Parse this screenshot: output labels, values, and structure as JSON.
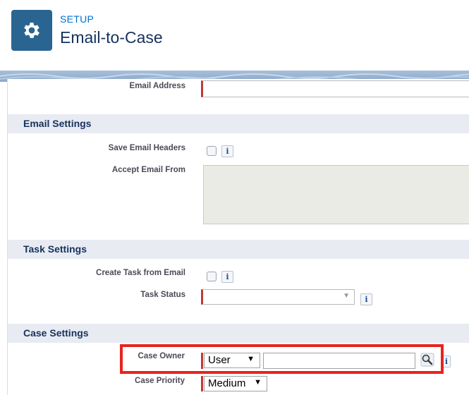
{
  "header": {
    "section": "SETUP",
    "title": "Email-to-Case",
    "icon": "gear-icon",
    "icon_bg": "#2a6592"
  },
  "fields": {
    "email_address_label": "Email Address",
    "email_address_value": ""
  },
  "sections": {
    "email_settings": {
      "title": "Email Settings",
      "save_headers_label": "Save Email Headers",
      "accept_from_label": "Accept Email From",
      "accept_from_value": ""
    },
    "task_settings": {
      "title": "Task Settings",
      "create_task_label": "Create Task from Email",
      "task_status_label": "Task Status",
      "task_status_value": ""
    },
    "case_settings": {
      "title": "Case Settings",
      "case_owner_label": "Case Owner",
      "case_owner_type": "User",
      "case_owner_value": "",
      "case_priority_label": "Case Priority",
      "case_priority_value": "Medium"
    }
  },
  "info_glyph": "i",
  "dropdown_glyph": "▼",
  "colors": {
    "required": "#c23934",
    "highlight": "#e8231f",
    "section_bg": "#e8ebf2"
  }
}
